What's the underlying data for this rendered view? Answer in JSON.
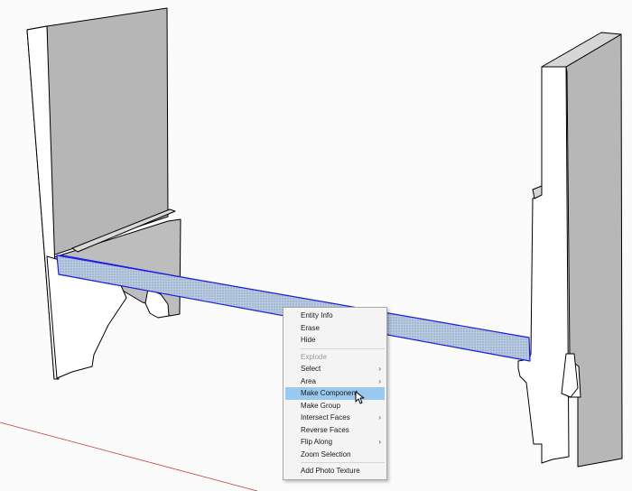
{
  "context_menu": {
    "groups": [
      [
        {
          "label": "Entity Info",
          "submenu": false,
          "enabled": true
        },
        {
          "label": "Erase",
          "submenu": false,
          "enabled": true
        },
        {
          "label": "Hide",
          "submenu": false,
          "enabled": true
        }
      ],
      [
        {
          "label": "Explode",
          "submenu": false,
          "enabled": false
        },
        {
          "label": "Select",
          "submenu": true,
          "enabled": true
        },
        {
          "label": "Area",
          "submenu": true,
          "enabled": true
        },
        {
          "label": "Make Component",
          "submenu": false,
          "enabled": true,
          "highlighted": true
        },
        {
          "label": "Make Group",
          "submenu": false,
          "enabled": true
        },
        {
          "label": "Intersect Faces",
          "submenu": true,
          "enabled": true
        },
        {
          "label": "Reverse Faces",
          "submenu": false,
          "enabled": true
        },
        {
          "label": "Flip Along",
          "submenu": true,
          "enabled": true
        },
        {
          "label": "Zoom Selection",
          "submenu": false,
          "enabled": true
        }
      ],
      [
        {
          "label": "Add Photo Texture",
          "submenu": false,
          "enabled": true
        }
      ]
    ],
    "submenu_glyph": "›"
  },
  "colors": {
    "background": "#fbfbfb",
    "face_gray": "#b6b6b6",
    "face_white": "#ffffff",
    "selection_blue": "#1a1ae6",
    "selected_face": "#b4c8dc",
    "axis_red": "#cc3333",
    "menu_highlight": "#99c9ef"
  },
  "icons": {
    "cursor": "pointer-arrow-icon"
  }
}
